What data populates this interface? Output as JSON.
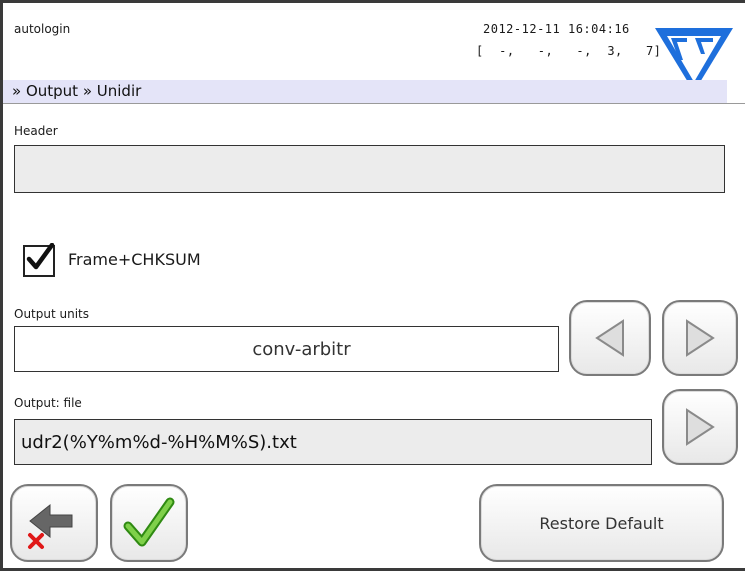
{
  "status_bar": {
    "user": "autologin",
    "datetime": "2012-12-11  16:04:16",
    "status": "[  -,   -,   -,  3,   7]"
  },
  "breadcrumb": "» Output » Unidir",
  "header_section": {
    "label": "Header",
    "value": ""
  },
  "checkbox": {
    "label": "Frame+CHKSUM",
    "checked": true
  },
  "output_units": {
    "label": "Output units",
    "value": "conv-arbitr"
  },
  "output_file": {
    "label": "Output: file",
    "value": "udr2(%Y%m%d-%H%M%S).txt"
  },
  "buttons": {
    "restore_default": "Restore Default"
  },
  "icons": {
    "logo": "77-logo-icon",
    "prev": "triangle-left-icon",
    "next": "triangle-right-icon",
    "cancel": "back-arrow-red-x-icon",
    "ok": "green-checkmark-icon",
    "checkbox": "checkmark-icon"
  },
  "colors": {
    "logo_blue": "#1e6fdc",
    "breadcrumb_bg": "#e4e4f8",
    "field_gray": "#ececec",
    "check_green": "#3aa018",
    "x_red": "#e01818"
  }
}
